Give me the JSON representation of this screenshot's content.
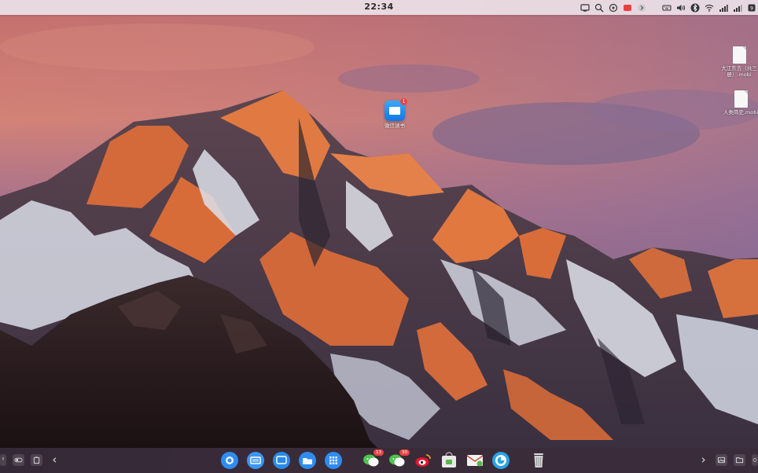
{
  "menubar": {
    "clock": "22:34"
  },
  "desktop": {
    "icons": [
      {
        "label": "微信读书",
        "badge": "1",
        "icon": "weread-icon"
      },
      {
        "label": "大江东去（共三册）.mobi",
        "icon": "file-icon"
      },
      {
        "label": "人类简史.mobi",
        "icon": "file-icon"
      }
    ]
  },
  "dock": {
    "apps": [
      {
        "name": "launcher",
        "icon": "launcher-icon"
      },
      {
        "name": "multitask-view",
        "icon": "multitask-icon"
      },
      {
        "name": "desktop",
        "icon": "desktop-icon"
      },
      {
        "name": "file-manager",
        "icon": "folder-icon"
      },
      {
        "name": "app-grid",
        "icon": "app-grid-icon"
      },
      {
        "name": "wechat-1",
        "icon": "wechat-icon",
        "badge": "13"
      },
      {
        "name": "wechat-2",
        "icon": "wechat-icon",
        "badge": "30"
      },
      {
        "name": "weibo",
        "icon": "weibo-icon"
      },
      {
        "name": "app-store",
        "icon": "store-icon"
      },
      {
        "name": "mail",
        "icon": "mail-icon"
      },
      {
        "name": "browser",
        "icon": "browser-icon"
      },
      {
        "name": "trash",
        "icon": "trash-icon"
      }
    ]
  },
  "colors": {
    "sky_top": "#c8707a",
    "sky_mid": "#a86a90",
    "mountain_lit": "#e0763a",
    "snow": "#dfe3ee",
    "dock_bg": "#1e161a",
    "menubar_bg": "#ebe1e8"
  }
}
